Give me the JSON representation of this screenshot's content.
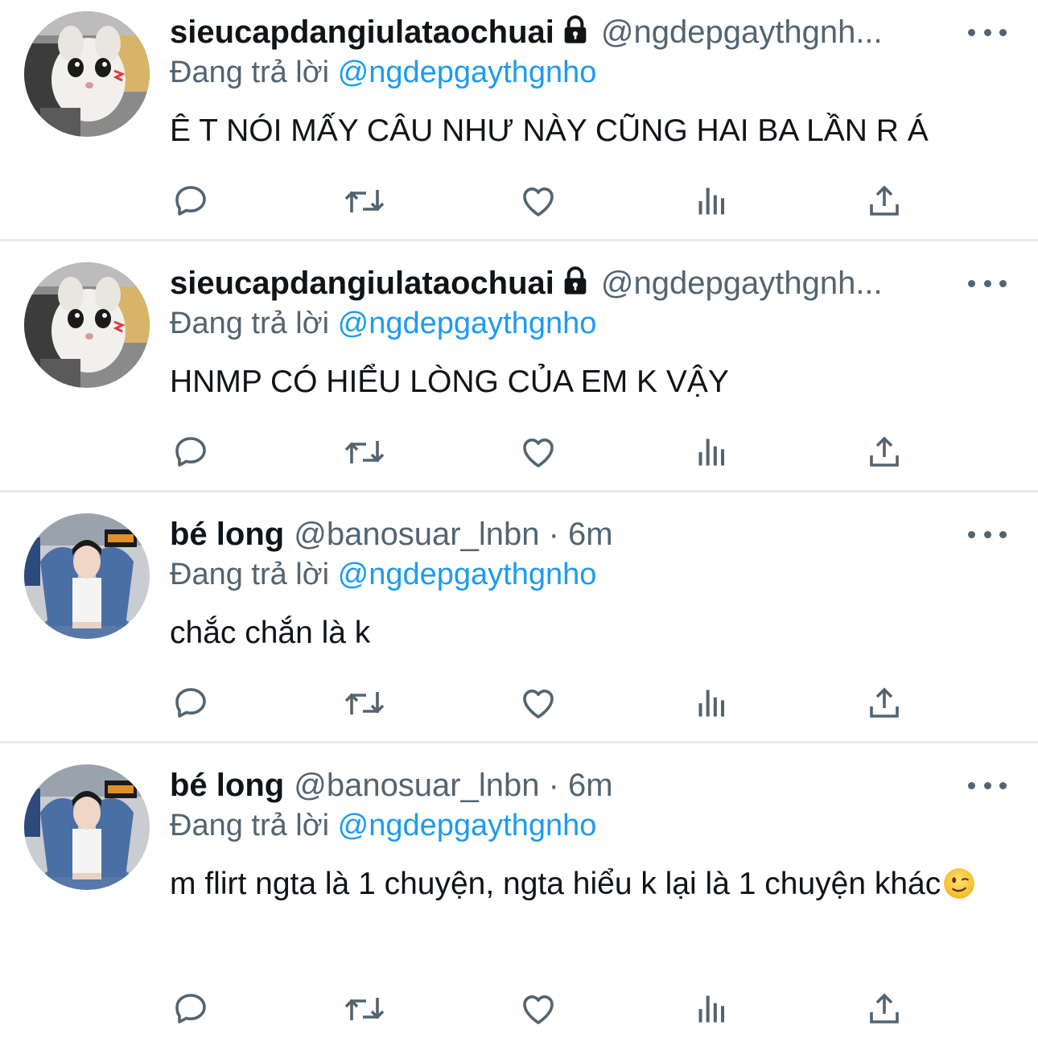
{
  "tweets": [
    {
      "name": "sieucapdangiulataochuai",
      "locked": true,
      "handle": "@ngdepgaythgnh...",
      "replying_label": "Đang trả lời",
      "replying_to": "@ngdepgaythgnho",
      "text": "Ê T NÓI MẤY CÂU NHƯ NÀY CŨNG HAI BA LẦN R Á",
      "avatar": "cat-avatar"
    },
    {
      "name": "sieucapdangiulataochuai",
      "locked": true,
      "handle": "@ngdepgaythgnh...",
      "replying_label": "Đang trả lời",
      "replying_to": "@ngdepgaythgnho",
      "text": "HNMP CÓ HIỂU LÒNG CỦA EM K VẬY",
      "avatar": "cat-avatar"
    },
    {
      "name": "bé long",
      "locked": false,
      "handle": "@banosuar_lnbn · 6m",
      "replying_label": "Đang trả lời",
      "replying_to": "@ngdepgaythgnho",
      "text": "chắc chắn là k",
      "avatar": "girl-avatar"
    },
    {
      "name": "bé long",
      "locked": false,
      "handle": "@banosuar_lnbn · 6m",
      "replying_label": "Đang trả lời",
      "replying_to": "@ngdepgaythgnho",
      "text": "m flirt ngta là 1 chuyện, ngta hiểu k lại là 1 chuyện khác",
      "text_emoji": "winking-face-emoji",
      "avatar": "girl-avatar"
    }
  ],
  "action_icons": [
    "reply-icon",
    "retweet-icon",
    "like-icon",
    "views-icon",
    "share-icon"
  ],
  "colors": {
    "secondary": "#536471",
    "link": "#1d9bf0",
    "divider": "#e7e9ea",
    "text": "#0f1419"
  }
}
